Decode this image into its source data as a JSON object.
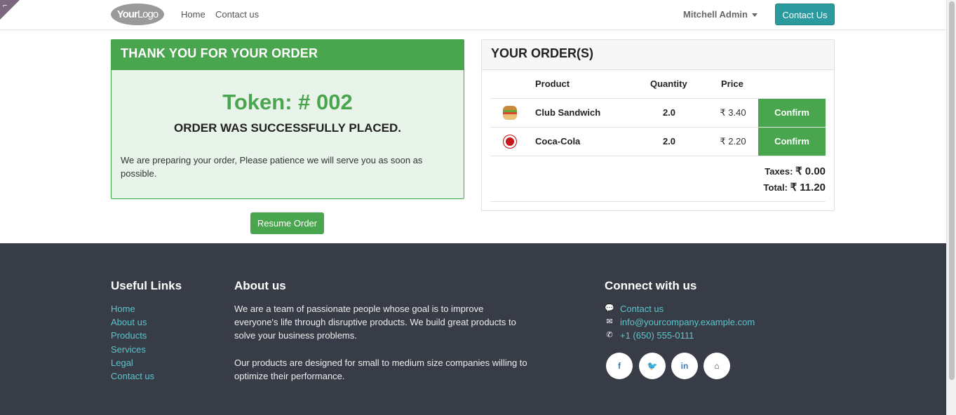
{
  "navbar": {
    "logo_text_a": "Your",
    "logo_text_b": "Logo",
    "links": [
      "Home",
      "Contact us"
    ],
    "user": "Mitchell Admin",
    "contact_button": "Contact Us"
  },
  "confirmation": {
    "header": "THANK YOU FOR YOUR ORDER",
    "token": "Token: # 002",
    "status": "ORDER WAS SUCCESSFULLY PLACED.",
    "message": "We are preparing your order, Please patience we will serve you as soon as possible.",
    "resume_button": "Resume Order"
  },
  "orders": {
    "header": "YOUR ORDER(S)",
    "columns": [
      "Product",
      "Quantity",
      "Price"
    ],
    "items": [
      {
        "product": "Club Sandwich",
        "quantity": "2.0",
        "price": "₹ 3.40",
        "action": "Confirm"
      },
      {
        "product": "Coca-Cola",
        "quantity": "2.0",
        "price": "₹ 2.20",
        "action": "Confirm"
      }
    ],
    "taxes_label": "Taxes:",
    "taxes_value": "₹ 0.00",
    "total_label": "Total:",
    "total_value": "₹ 11.20"
  },
  "footer": {
    "useful_links_title": "Useful Links",
    "useful_links": [
      "Home",
      "About us",
      "Products",
      "Services",
      "Legal",
      "Contact us"
    ],
    "about_title": "About us",
    "about_p1": "We are a team of passionate people whose goal is to improve everyone's life through disruptive products. We build great products to solve your business problems.",
    "about_p2": "Our products are designed for small to medium size companies willing to optimize their performance.",
    "connect_title": "Connect with us",
    "contact_items": [
      {
        "icon": "comment-icon",
        "text": "Contact us"
      },
      {
        "icon": "envelope-icon",
        "text": "info@yourcompany.example.com"
      },
      {
        "icon": "phone-icon",
        "text": "+1 (650) 555-0111"
      }
    ],
    "socials": [
      {
        "icon": "facebook-icon",
        "glyph": "f"
      },
      {
        "icon": "twitter-icon",
        "glyph": "🐦"
      },
      {
        "icon": "linkedin-icon",
        "glyph": "in"
      },
      {
        "icon": "home-icon",
        "glyph": "⌂"
      }
    ]
  },
  "colors": {
    "primary_green": "#4aa64e",
    "teal_button": "#2b9a9e",
    "footer_bg": "#373c46",
    "link_teal": "#5ec4cc"
  }
}
